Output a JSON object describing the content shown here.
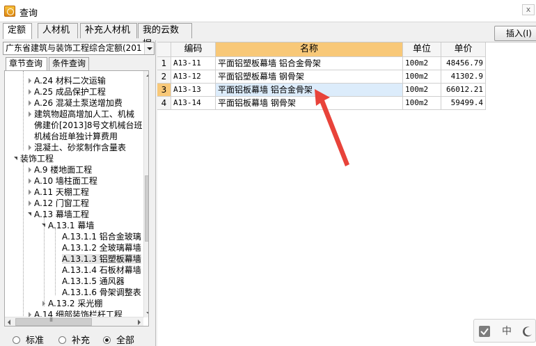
{
  "window": {
    "title": "查询",
    "close_label": "x"
  },
  "tabs": [
    {
      "label": "定额",
      "active": true
    },
    {
      "label": "人材机"
    },
    {
      "label": "补充人材机"
    },
    {
      "label": "我的云数据"
    }
  ],
  "toolbar": {
    "insert_label": "插入(I)"
  },
  "quota_select": {
    "value": "广东省建筑与装饰工程综合定额(201"
  },
  "subtabs": [
    {
      "label": "章节查询",
      "active": true
    },
    {
      "label": "条件查询"
    }
  ],
  "tree": [
    {
      "label": "A.24 材料二次运输",
      "expander": "closed"
    },
    {
      "label": "A.25 成品保护工程",
      "expander": "closed"
    },
    {
      "label": "A.26 混凝土泵送增加费",
      "expander": "closed"
    },
    {
      "label": "建筑物超高增加人工、机械",
      "expander": "closed"
    },
    {
      "label": "佛建价[2013]8号文机械台班",
      "expander": "none"
    },
    {
      "label": "机械台班单独计算费用",
      "expander": "none"
    },
    {
      "label": "混凝土、砂浆制作含量表",
      "expander": "closed"
    },
    {
      "label": "装饰工程",
      "expander": "open"
    },
    {
      "label": "A.9 楼地面工程",
      "expander": "closed"
    },
    {
      "label": "A.10 墙柱面工程",
      "expander": "closed"
    },
    {
      "label": "A.11 天棚工程",
      "expander": "closed"
    },
    {
      "label": "A.12 门窗工程",
      "expander": "closed"
    },
    {
      "label": "A.13 幕墙工程",
      "expander": "open"
    },
    {
      "label": "A.13.1 幕墙",
      "expander": "open"
    },
    {
      "label": "A.13.1.1 铝合金玻璃",
      "expander": "none"
    },
    {
      "label": "A.13.1.2 全玻璃幕墙",
      "expander": "none"
    },
    {
      "label": "A.13.1.3 铝塑板幕墙",
      "expander": "none",
      "selected": true
    },
    {
      "label": "A.13.1.4 石板材幕墙",
      "expander": "none"
    },
    {
      "label": "A.13.1.5 通风器",
      "expander": "none"
    },
    {
      "label": "A.13.1.6 骨架调整表",
      "expander": "none"
    },
    {
      "label": "A.13.2 采光棚",
      "expander": "closed"
    },
    {
      "label": "A.14 细部装饰栏杆工程",
      "expander": "closed"
    }
  ],
  "filter": {
    "options": [
      {
        "label": "标准",
        "checked": false
      },
      {
        "label": "补充",
        "checked": false
      },
      {
        "label": "全部",
        "checked": true
      }
    ]
  },
  "table": {
    "columns": [
      "",
      "编码",
      "名称",
      "单位",
      "单价"
    ],
    "rows": [
      {
        "num": "1",
        "code": "A13-11",
        "name": "平面铝塑板幕墙 铝合金骨架",
        "unit": "100m2",
        "price": "48456.79"
      },
      {
        "num": "2",
        "code": "A13-12",
        "name": "平面铝塑板幕墙 钢骨架",
        "unit": "100m2",
        "price": "41302.9"
      },
      {
        "num": "3",
        "code": "A13-13",
        "name": "平面铝板幕墙 铝合金骨架",
        "unit": "100m2",
        "price": "66012.21",
        "selected": true
      },
      {
        "num": "4",
        "code": "A13-14",
        "name": "平面铝板幕墙 钢骨架",
        "unit": "100m2",
        "price": "59499.4"
      }
    ]
  },
  "annotation": {
    "color": "#e8433a",
    "icon": "red-arrow"
  },
  "ime": {
    "mode_label": "中",
    "items": [
      "check-icon",
      "chinese-mode",
      "moon-icon"
    ]
  }
}
